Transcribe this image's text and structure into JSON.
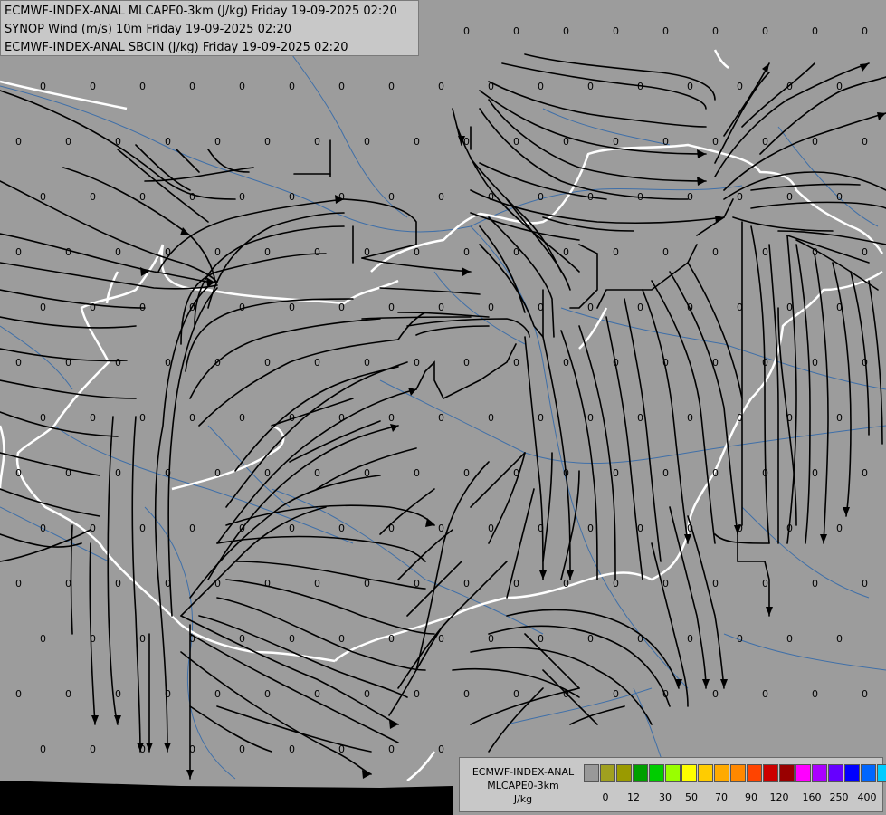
{
  "header": {
    "line1": "ECMWF-INDEX-ANAL MLCAPE0-3km (J/kg) Friday 19-09-2025 02:20",
    "line2": "SYNOP Wind (m/s) 10m Friday 19-09-2025 02:20",
    "line3": "ECMWF-INDEX-ANAL SBCIN (J/kg) Friday 19-09-2025 02:20"
  },
  "colorbar": {
    "line1": "ECMWF-INDEX-ANAL",
    "line2": "MLCAPE0-3km",
    "unit": "J/kg",
    "colors": [
      "#999999",
      "#a0a020",
      "#9a9a00",
      "#00a000",
      "#00cc00",
      "#99ff00",
      "#ffff00",
      "#ffcc00",
      "#ffaa00",
      "#ff8800",
      "#ff4400",
      "#cc0000",
      "#990000",
      "#ff00ff",
      "#aa00ff",
      "#6600ff",
      "#0000ff",
      "#0066ff",
      "#00ccff",
      "#66ffff",
      "#ffffff"
    ],
    "ticks": [
      "0",
      "12",
      "30",
      "50",
      "70",
      "90",
      "120",
      "160",
      "250",
      "400"
    ]
  },
  "map": {
    "background": "#9c9c9c",
    "border_color": "#ffffff",
    "river_color": "#3f6fa8",
    "streamline_color": "#000000",
    "cin_label": "0"
  }
}
